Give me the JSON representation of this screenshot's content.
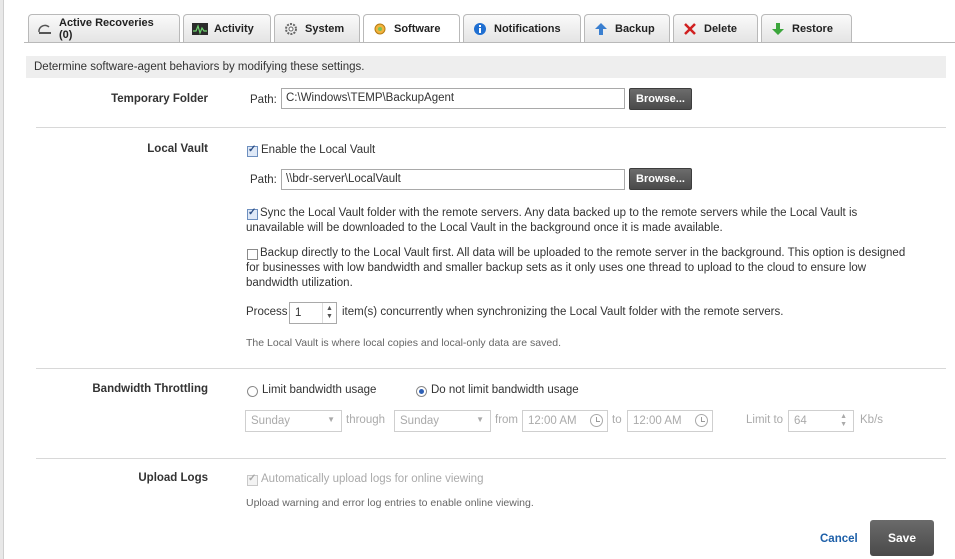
{
  "tabs": [
    {
      "label": "Active Recoveries (0)",
      "icon": "recovery-icon"
    },
    {
      "label": "Activity",
      "icon": "activity-icon"
    },
    {
      "label": "System",
      "icon": "gear-icon"
    },
    {
      "label": "Software",
      "icon": "software-icon"
    },
    {
      "label": "Notifications",
      "icon": "info-icon"
    },
    {
      "label": "Backup",
      "icon": "up-arrow-icon"
    },
    {
      "label": "Delete",
      "icon": "x-icon"
    },
    {
      "label": "Restore",
      "icon": "down-arrow-icon"
    }
  ],
  "active_tab": "Software",
  "description": "Determine software-agent behaviors by modifying these settings.",
  "temporary_folder": {
    "label": "Temporary Folder",
    "path_label": "Path:",
    "path_value": "C:\\Windows\\TEMP\\BackupAgent",
    "browse_label": "Browse..."
  },
  "local_vault": {
    "label": "Local Vault",
    "enable_label": "Enable the Local Vault",
    "enable_checked": true,
    "path_label": "Path:",
    "path_value": "\\\\bdr-server\\LocalVault",
    "browse_label": "Browse...",
    "sync_text": "Sync the Local Vault folder with the remote servers. Any data backed up to the remote servers while the Local Vault is unavailable will be downloaded to the Local Vault in the background once it is made available.",
    "sync_checked": true,
    "backup_first_text": "Backup directly to the Local Vault first. All data will be uploaded to the remote server in the background. This option is designed for businesses with low bandwidth and smaller backup sets as it only uses one thread to upload to the cloud to ensure low bandwidth utilization.",
    "backup_first_checked": false,
    "process_label": "Process",
    "process_value": "1",
    "process_suffix": "item(s) concurrently when synchronizing the Local Vault folder with the remote servers.",
    "note": "The Local Vault is where local copies and local-only data are saved."
  },
  "bandwidth": {
    "label": "Bandwidth Throttling",
    "limit_label": "Limit bandwidth usage",
    "nolimit_label": "Do not limit bandwidth usage",
    "selected": "nolimit",
    "day_from": "Sunday",
    "through_label": "through",
    "day_to": "Sunday",
    "from_label": "from",
    "time_from": "12:00 AM",
    "to_label": "to",
    "time_to": "12:00 AM",
    "limit_to_label": "Limit to",
    "limit_value": "64",
    "unit": "Kb/s"
  },
  "upload_logs": {
    "label": "Upload Logs",
    "auto_label": "Automatically upload logs for online viewing",
    "auto_checked": true,
    "note": "Upload warning and error log entries to enable online viewing."
  },
  "footer": {
    "cancel_label": "Cancel",
    "save_label": "Save"
  },
  "colors": {
    "accent_link": "#1d5fa8",
    "button_dark": "#555555"
  }
}
